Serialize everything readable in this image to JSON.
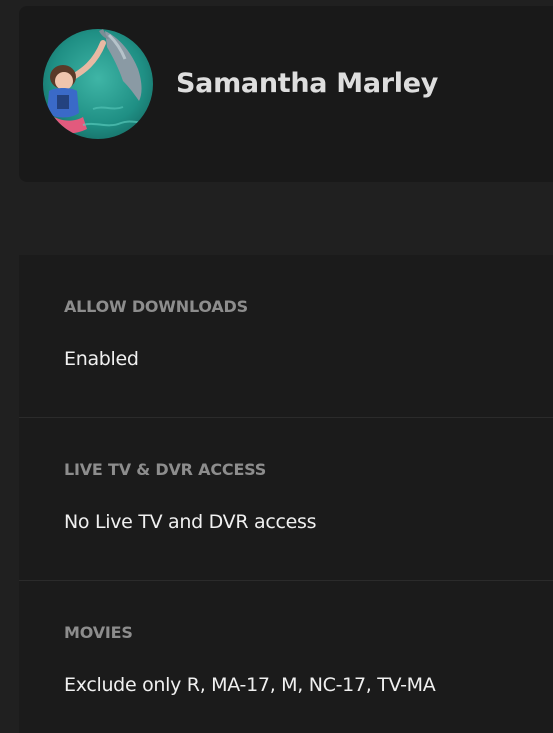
{
  "profile": {
    "name": "Samantha Marley"
  },
  "settings": [
    {
      "label": "ALLOW DOWNLOADS",
      "value": "Enabled"
    },
    {
      "label": "LIVE TV & DVR ACCESS",
      "value": "No Live TV and DVR access"
    },
    {
      "label": "MOVIES",
      "value": "Exclude only R, MA-17, M, NC-17, TV-MA"
    }
  ],
  "colors": {
    "background": "#202020",
    "card": "#191919",
    "label": "#8d8d8d",
    "value": "#f0f0f0"
  }
}
